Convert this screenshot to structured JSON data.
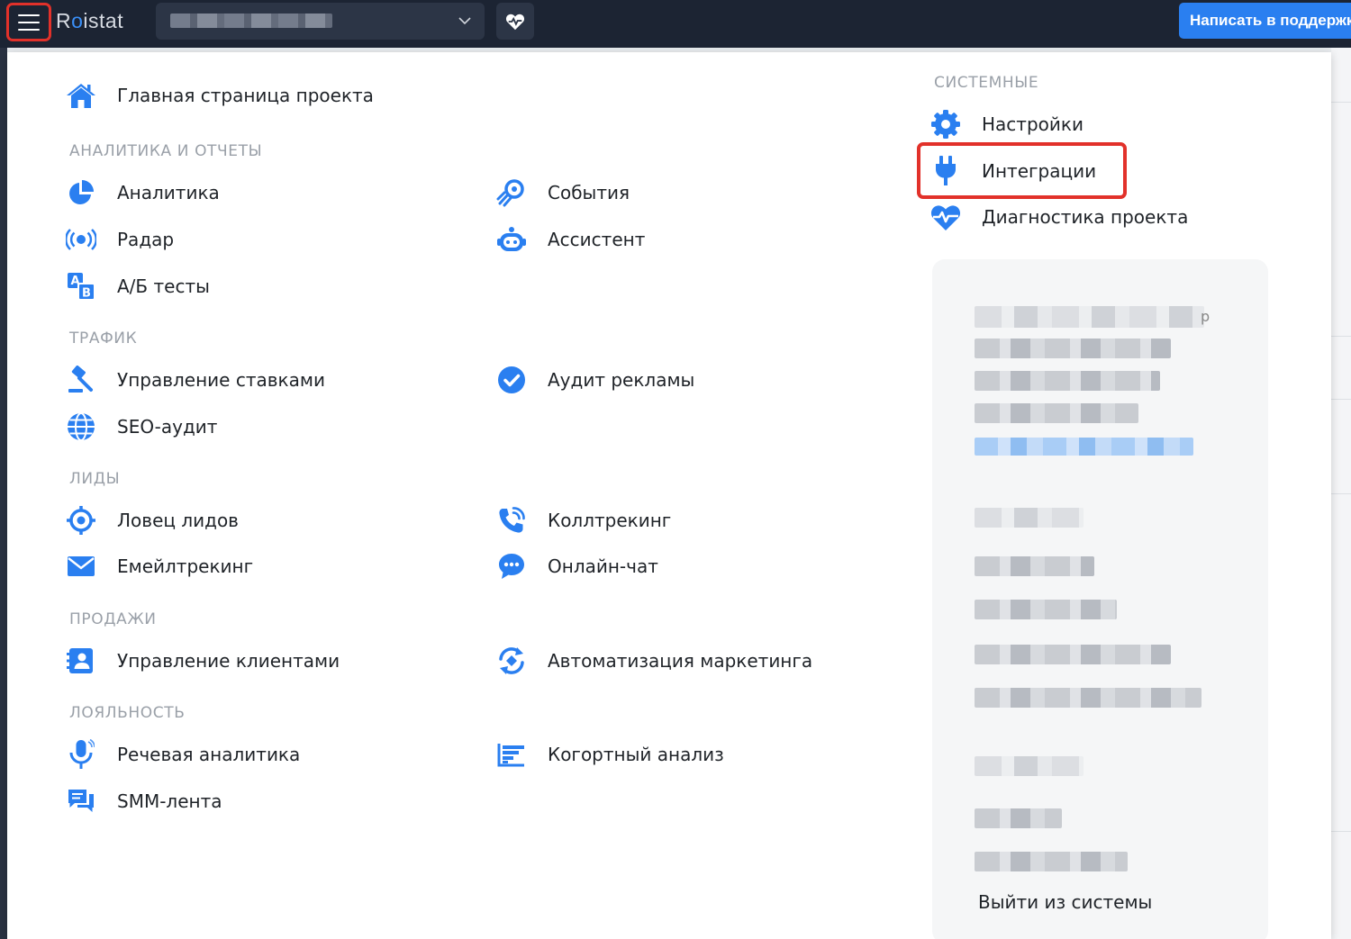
{
  "topbar": {
    "logo_prefix": "R",
    "logo_o": "o",
    "logo_suffix": "istat",
    "support_label": "Написать в поддержку",
    "menu_icon": "hamburger-icon",
    "health_icon": "heart-pulse-icon",
    "dropdown_icon": "chevron-down-icon"
  },
  "menu": {
    "home": {
      "label": "Главная страница проекта",
      "icon": "home-icon"
    },
    "sections": {
      "analytics": "АНАЛИТИКА И ОТЧЕТЫ",
      "traffic": "ТРАФИК",
      "leads": "ЛИДЫ",
      "sales": "ПРОДАЖИ",
      "loyalty": "ЛОЯЛЬНОСТЬ",
      "system": "СИСТЕМНЫЕ"
    },
    "items": {
      "analytics": "Аналитика",
      "events": "События",
      "radar": "Радар",
      "assistant": "Ассистент",
      "ab_tests": "А/Б тесты",
      "bid_management": "Управление ставками",
      "ads_audit": "Аудит рекламы",
      "seo_audit": "SEO-аудит",
      "lead_catcher": "Ловец лидов",
      "calltracking": "Коллтрекинг",
      "emailtracking": "Емейлтрекинг",
      "online_chat": "Онлайн-чат",
      "client_management": "Управление клиентами",
      "marketing_automation": "Автоматизация маркетинга",
      "speech_analytics": "Речевая аналитика",
      "cohort_analysis": "Когортный анализ",
      "smm_feed": "SMM-лента",
      "settings": "Настройки",
      "integrations": "Интеграции",
      "project_diagnostics": "Диагностика проекта"
    }
  },
  "user_card": {
    "trailing_char": "р",
    "logout_label": "Выйти из системы"
  },
  "colors": {
    "topbar_bg": "#1c2433",
    "accent_blue": "#2a7ff0",
    "highlight_red": "#e2312a",
    "section_gray": "#9aa0a8"
  }
}
